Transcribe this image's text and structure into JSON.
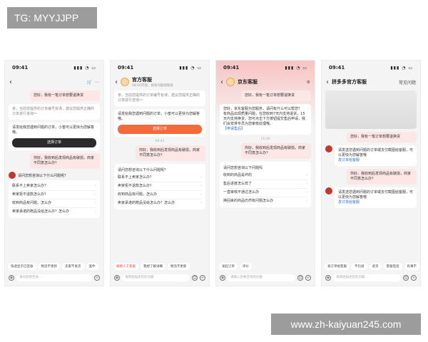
{
  "watermark_top": "TG: MYYJJPP",
  "watermark_bottom": "www.zh-kaiyuan245.com",
  "phones": [
    {
      "time": "09:41",
      "title": "",
      "msg_user": "您好，我有一笔订单想要退换货",
      "msg_bot1": "亲，当前您提供的订单编号有误，建议您提供正确的订单进行咨询～",
      "msg_bot2": "请发给我您遇到问题的订单，小蜜可以更快为您解答哦。",
      "select_btn": "选择订单",
      "msg_user2": "你好，我收到后发现商品有破损，商家不同意怎么办？",
      "question_head": "请问您想咨询以下什么问题呢？",
      "questions": [
        "联系不上卖家怎么办？",
        "卖家拒不退款怎么办？",
        "收到商品有问题，怎么办",
        "卖家承诺的赠品没给怎么办？怎么办"
      ],
      "chips": [
        "快递显示已签收",
        "物流不更新",
        "卖家不发货",
        "查件"
      ],
      "input_placeholder": "请问您想咨询..."
    },
    {
      "time": "09:41",
      "title": "官方客服",
      "subtitle": "08:00开放，如有问题请联系",
      "msg_bot1": "亲，当前您提供的订单编号有误，建议您提供正确的订单进行咨询～",
      "msg_bot2": "请发给我您遇到问题的订单，小蜜可以更快为您解答哦。",
      "select_btn": "选择订单",
      "time_mark": "09:41",
      "msg_user2": "你好，我收到后发现商品有破损，商家不同意怎么办？",
      "question_head": "请问您想咨询以下什么问题呢？",
      "questions": [
        "联系不上卖家怎么办？",
        "卖家拒不退款怎么办？",
        "收到商品有问题，怎么办",
        "卖家承诺的赠品没给怎么办？怎么办"
      ],
      "chips": [
        "联络人工客服",
        "我想了解详细",
        "物流不更新"
      ],
      "input_placeholder": "请简短描述您的问题"
    },
    {
      "time": "09:41",
      "title": "京东客服",
      "msg_user": "您好，我有一笔订单想要退换货",
      "msg_bot1": "您好，京东客服为您服务，请问有什么可以帮您？",
      "msg_bot2": "有商品出现质量问题，在您收到7天内支持退货，15天内支持换货，您可点击下方按钮提交售后申请，我们会安排专员为您审核处理哦。",
      "link": "【申请售后】",
      "time_mark": "15:30",
      "msg_user2": "你好，我收到后发现商品有破损，商家不同意怎么办？",
      "question_head": "请问您想咨询以下问题吗",
      "questions": [
        "收到的商品是坏的",
        "售后进度怎么样了",
        "一直审核不通过怎么办",
        "换回来的商品仍然有问题怎么办"
      ],
      "chips": [
        "发起订单",
        "评价"
      ],
      "input_placeholder": "请输入您要咨询的问题"
    },
    {
      "time": "09:41",
      "title": "拼多多官方客服",
      "right": "常见问题",
      "msg_user": "您好，我有一笔订单想要退换货",
      "msg_bot1": "请发送您遇到问题的订单或支付截图给客服，可以更快为您解答哦",
      "link": "发订单给客服",
      "msg_user2": "你好，我收到后发现商品有破损，商家不同意怎么办？",
      "msg_bot2": "请发送您遇到问题的订单或支付截图给客服，可以更快为您解答哦",
      "link2": "发订单给客服",
      "chips": [
        "发订单给客服",
        "不包退",
        "退货",
        "客服电话",
        "有事不"
      ],
      "input_placeholder": "请简短描述您的问题..."
    }
  ]
}
